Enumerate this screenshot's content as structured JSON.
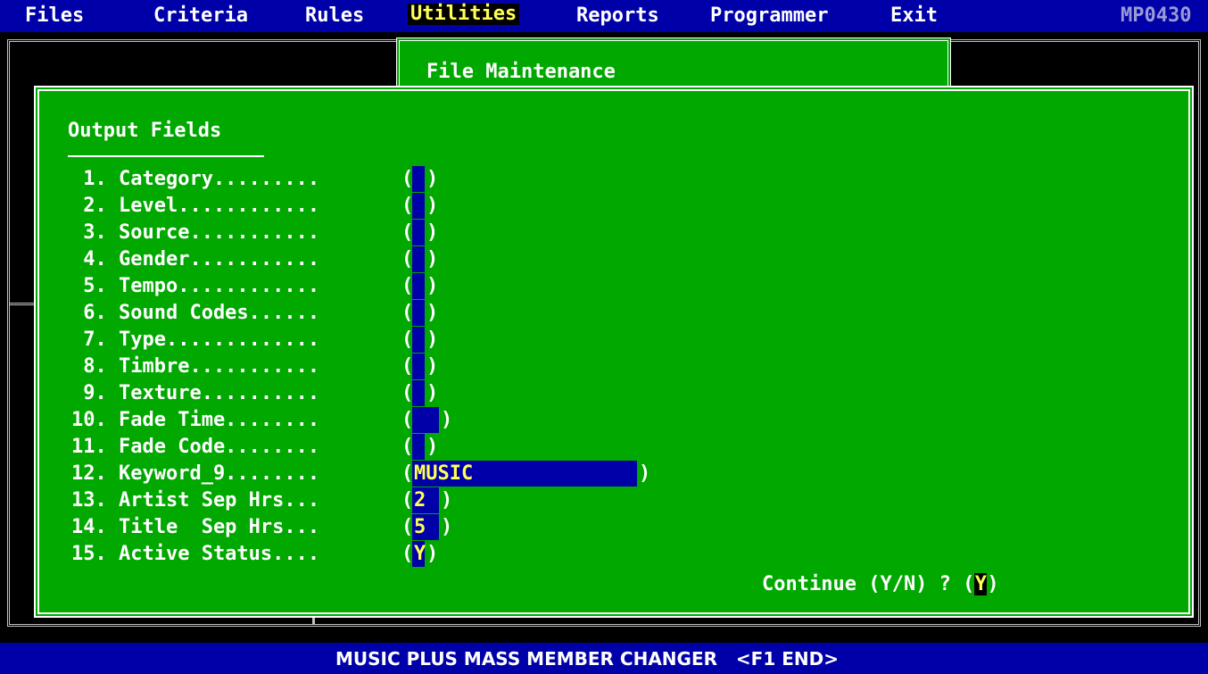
{
  "menu": {
    "items": [
      "Files",
      "Criteria",
      "Rules",
      "Utilities",
      "Reports",
      "Programmer",
      "Exit"
    ],
    "active": "Utilities",
    "program_id": "MP0430"
  },
  "title_window": {
    "title": "File Maintenance"
  },
  "main_window": {
    "heading": "Output Fields",
    "fields": [
      {
        "label": " 1. Category.........",
        "value": ""
      },
      {
        "label": " 2. Level............",
        "value": ""
      },
      {
        "label": " 3. Source...........",
        "value": ""
      },
      {
        "label": " 4. Gender...........",
        "value": ""
      },
      {
        "label": " 5. Tempo............",
        "value": ""
      },
      {
        "label": " 6. Sound Codes......",
        "value": ""
      },
      {
        "label": " 7. Type.............",
        "value": ""
      },
      {
        "label": " 8. Timbre...........",
        "value": ""
      },
      {
        "label": " 9. Texture..........",
        "value": ""
      },
      {
        "label": "10. Fade Time........",
        "value": ""
      },
      {
        "label": "11. Fade Code........",
        "value": ""
      },
      {
        "label": "12. Keyword_9........",
        "value": "MUSIC"
      },
      {
        "label": "13. Artist Sep Hrs...",
        "value": "2"
      },
      {
        "label": "14. Title  Sep Hrs...",
        "value": "5"
      },
      {
        "label": "15. Active Status....",
        "value": "Y"
      }
    ],
    "prompt": {
      "text": "Continue (Y/N) ? (",
      "answer": "Y",
      "close": ")"
    }
  },
  "status_bar": {
    "text": "MUSIC PLUS MASS MEMBER CHANGER   <F1 END>"
  },
  "colors": {
    "menu_bg": "#0000a8",
    "window_bg": "#00a800",
    "highlight": "#ffff55"
  }
}
